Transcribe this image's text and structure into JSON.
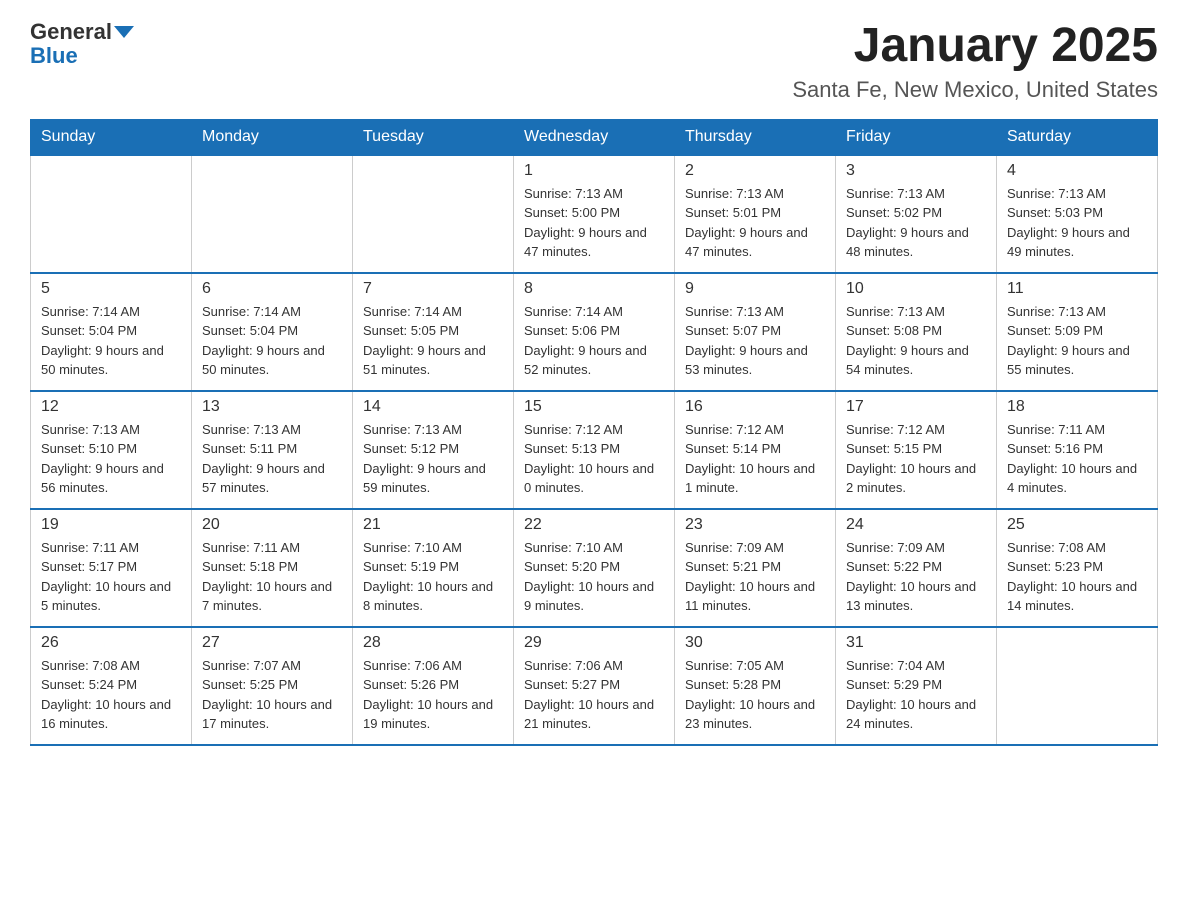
{
  "logo": {
    "general": "General",
    "blue": "Blue"
  },
  "title": {
    "month": "January 2025",
    "location": "Santa Fe, New Mexico, United States"
  },
  "days_of_week": [
    "Sunday",
    "Monday",
    "Tuesday",
    "Wednesday",
    "Thursday",
    "Friday",
    "Saturday"
  ],
  "weeks": [
    [
      {
        "day": "",
        "info": ""
      },
      {
        "day": "",
        "info": ""
      },
      {
        "day": "",
        "info": ""
      },
      {
        "day": "1",
        "info": "Sunrise: 7:13 AM\nSunset: 5:00 PM\nDaylight: 9 hours and 47 minutes."
      },
      {
        "day": "2",
        "info": "Sunrise: 7:13 AM\nSunset: 5:01 PM\nDaylight: 9 hours and 47 minutes."
      },
      {
        "day": "3",
        "info": "Sunrise: 7:13 AM\nSunset: 5:02 PM\nDaylight: 9 hours and 48 minutes."
      },
      {
        "day": "4",
        "info": "Sunrise: 7:13 AM\nSunset: 5:03 PM\nDaylight: 9 hours and 49 minutes."
      }
    ],
    [
      {
        "day": "5",
        "info": "Sunrise: 7:14 AM\nSunset: 5:04 PM\nDaylight: 9 hours and 50 minutes."
      },
      {
        "day": "6",
        "info": "Sunrise: 7:14 AM\nSunset: 5:04 PM\nDaylight: 9 hours and 50 minutes."
      },
      {
        "day": "7",
        "info": "Sunrise: 7:14 AM\nSunset: 5:05 PM\nDaylight: 9 hours and 51 minutes."
      },
      {
        "day": "8",
        "info": "Sunrise: 7:14 AM\nSunset: 5:06 PM\nDaylight: 9 hours and 52 minutes."
      },
      {
        "day": "9",
        "info": "Sunrise: 7:13 AM\nSunset: 5:07 PM\nDaylight: 9 hours and 53 minutes."
      },
      {
        "day": "10",
        "info": "Sunrise: 7:13 AM\nSunset: 5:08 PM\nDaylight: 9 hours and 54 minutes."
      },
      {
        "day": "11",
        "info": "Sunrise: 7:13 AM\nSunset: 5:09 PM\nDaylight: 9 hours and 55 minutes."
      }
    ],
    [
      {
        "day": "12",
        "info": "Sunrise: 7:13 AM\nSunset: 5:10 PM\nDaylight: 9 hours and 56 minutes."
      },
      {
        "day": "13",
        "info": "Sunrise: 7:13 AM\nSunset: 5:11 PM\nDaylight: 9 hours and 57 minutes."
      },
      {
        "day": "14",
        "info": "Sunrise: 7:13 AM\nSunset: 5:12 PM\nDaylight: 9 hours and 59 minutes."
      },
      {
        "day": "15",
        "info": "Sunrise: 7:12 AM\nSunset: 5:13 PM\nDaylight: 10 hours and 0 minutes."
      },
      {
        "day": "16",
        "info": "Sunrise: 7:12 AM\nSunset: 5:14 PM\nDaylight: 10 hours and 1 minute."
      },
      {
        "day": "17",
        "info": "Sunrise: 7:12 AM\nSunset: 5:15 PM\nDaylight: 10 hours and 2 minutes."
      },
      {
        "day": "18",
        "info": "Sunrise: 7:11 AM\nSunset: 5:16 PM\nDaylight: 10 hours and 4 minutes."
      }
    ],
    [
      {
        "day": "19",
        "info": "Sunrise: 7:11 AM\nSunset: 5:17 PM\nDaylight: 10 hours and 5 minutes."
      },
      {
        "day": "20",
        "info": "Sunrise: 7:11 AM\nSunset: 5:18 PM\nDaylight: 10 hours and 7 minutes."
      },
      {
        "day": "21",
        "info": "Sunrise: 7:10 AM\nSunset: 5:19 PM\nDaylight: 10 hours and 8 minutes."
      },
      {
        "day": "22",
        "info": "Sunrise: 7:10 AM\nSunset: 5:20 PM\nDaylight: 10 hours and 9 minutes."
      },
      {
        "day": "23",
        "info": "Sunrise: 7:09 AM\nSunset: 5:21 PM\nDaylight: 10 hours and 11 minutes."
      },
      {
        "day": "24",
        "info": "Sunrise: 7:09 AM\nSunset: 5:22 PM\nDaylight: 10 hours and 13 minutes."
      },
      {
        "day": "25",
        "info": "Sunrise: 7:08 AM\nSunset: 5:23 PM\nDaylight: 10 hours and 14 minutes."
      }
    ],
    [
      {
        "day": "26",
        "info": "Sunrise: 7:08 AM\nSunset: 5:24 PM\nDaylight: 10 hours and 16 minutes."
      },
      {
        "day": "27",
        "info": "Sunrise: 7:07 AM\nSunset: 5:25 PM\nDaylight: 10 hours and 17 minutes."
      },
      {
        "day": "28",
        "info": "Sunrise: 7:06 AM\nSunset: 5:26 PM\nDaylight: 10 hours and 19 minutes."
      },
      {
        "day": "29",
        "info": "Sunrise: 7:06 AM\nSunset: 5:27 PM\nDaylight: 10 hours and 21 minutes."
      },
      {
        "day": "30",
        "info": "Sunrise: 7:05 AM\nSunset: 5:28 PM\nDaylight: 10 hours and 23 minutes."
      },
      {
        "day": "31",
        "info": "Sunrise: 7:04 AM\nSunset: 5:29 PM\nDaylight: 10 hours and 24 minutes."
      },
      {
        "day": "",
        "info": ""
      }
    ]
  ]
}
